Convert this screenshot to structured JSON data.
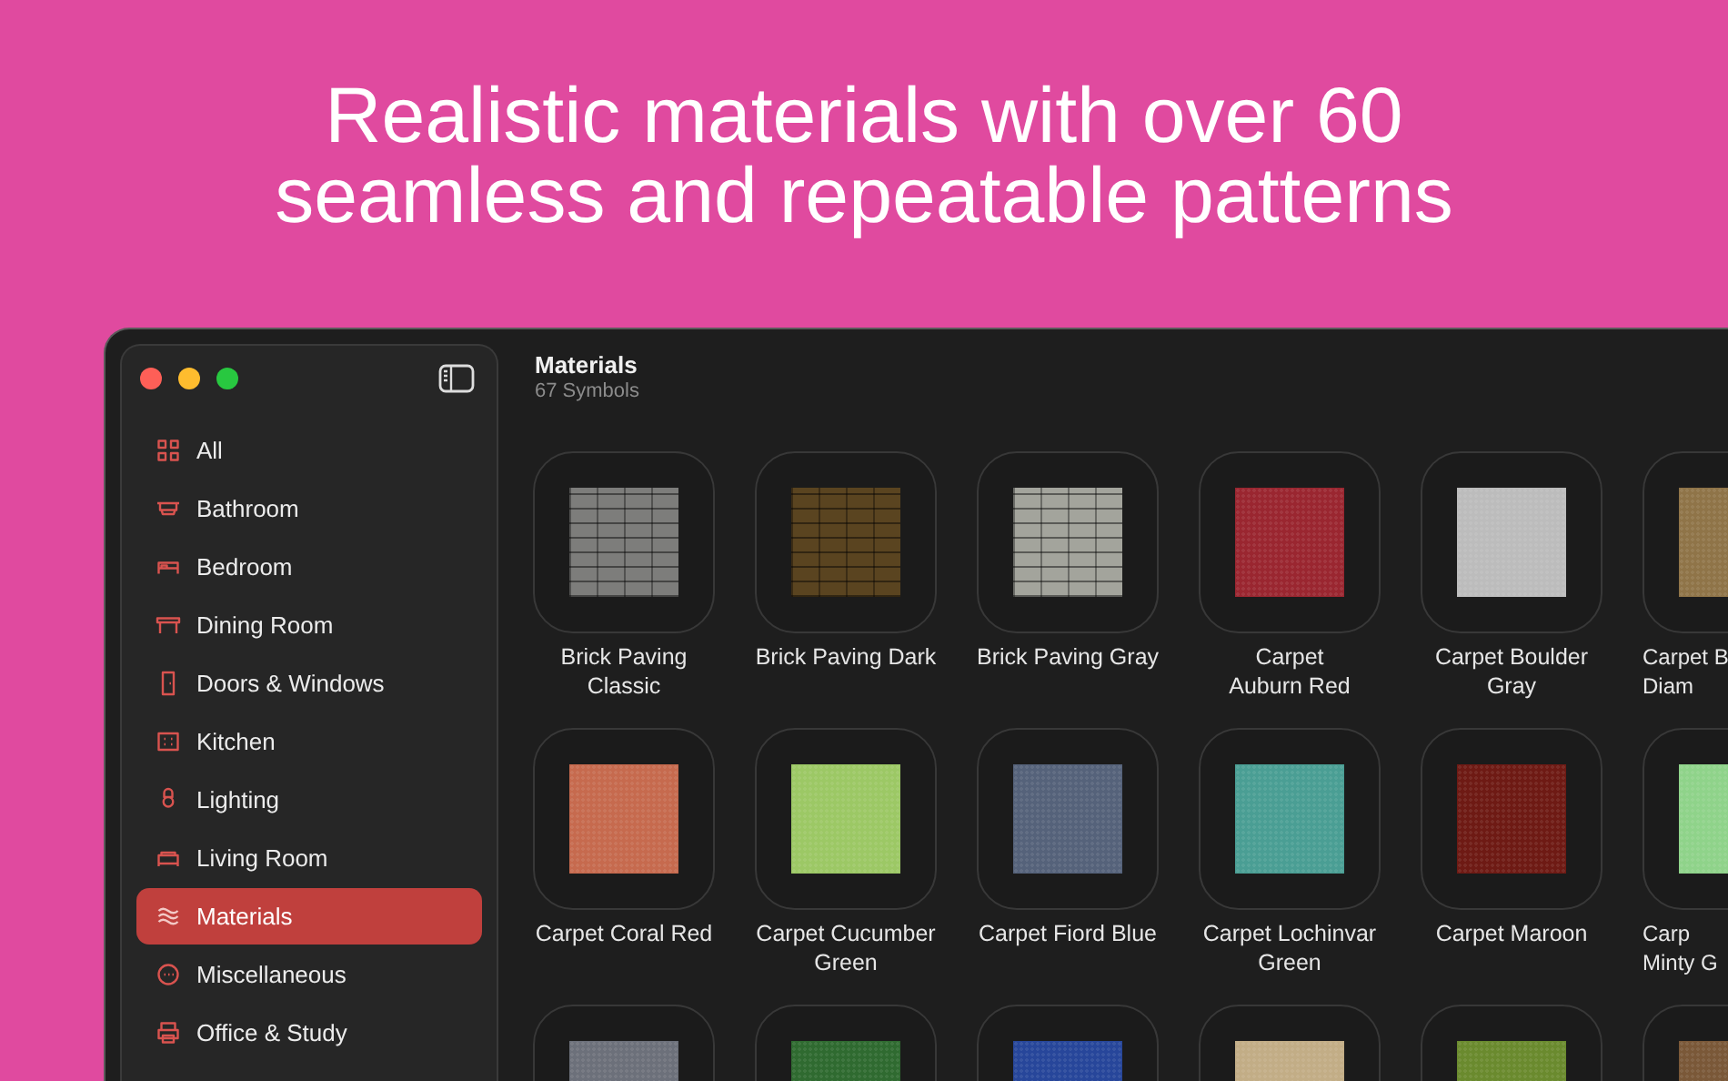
{
  "headline": [
    "Realistic materials with over 60",
    "seamless and repeatable patterns"
  ],
  "sidebar": {
    "items": [
      {
        "label": "All",
        "selected": false
      },
      {
        "label": "Bathroom",
        "selected": false
      },
      {
        "label": "Bedroom",
        "selected": false
      },
      {
        "label": "Dining Room",
        "selected": false
      },
      {
        "label": "Doors & Windows",
        "selected": false
      },
      {
        "label": "Kitchen",
        "selected": false
      },
      {
        "label": "Lighting",
        "selected": false
      },
      {
        "label": "Living Room",
        "selected": false
      },
      {
        "label": "Materials",
        "selected": true
      },
      {
        "label": "Miscellaneous",
        "selected": false
      },
      {
        "label": "Office & Study",
        "selected": false
      }
    ]
  },
  "header": {
    "title": "Materials",
    "subtitle": "67 Symbols"
  },
  "rows": [
    [
      {
        "kind": "brick",
        "color": "#7d7d7b",
        "label": "Brick Paving\nClassic"
      },
      {
        "kind": "brick",
        "color": "#5a4420",
        "label": "Brick Paving Dark"
      },
      {
        "kind": "brick",
        "color": "#a3a49c",
        "label": "Brick Paving Gray"
      },
      {
        "kind": "solid",
        "color": "#9a2630",
        "label": "Carpet\nAuburn Red"
      },
      {
        "kind": "solid",
        "color": "#bcbcbc",
        "label": "Carpet Boulder\nGray"
      },
      {
        "kind": "solid",
        "color": "#8f7448",
        "label": "Carpet B\nDiam"
      }
    ],
    [
      {
        "kind": "solid",
        "color": "#c66a4e",
        "label": "Carpet Coral Red"
      },
      {
        "kind": "solid",
        "color": "#9cc865",
        "label": "Carpet Cucumber\nGreen"
      },
      {
        "kind": "solid",
        "color": "#55627a",
        "label": "Carpet Fiord Blue"
      },
      {
        "kind": "solid",
        "color": "#4a9e94",
        "label": "Carpet Lochinvar\nGreen"
      },
      {
        "kind": "solid",
        "color": "#6e1a14",
        "label": "Carpet Maroon"
      },
      {
        "kind": "solid",
        "color": "#8fd38a",
        "label": "Carp\nMinty G"
      }
    ],
    [
      {
        "kind": "solid",
        "color": "#6c707a"
      },
      {
        "kind": "solid",
        "color": "#2f6a30"
      },
      {
        "kind": "solid",
        "color": "#27469a"
      },
      {
        "kind": "solid",
        "color": "#c2ad86"
      },
      {
        "kind": "solid",
        "color": "#6a8a2e"
      },
      {
        "kind": "solid",
        "color": "#7a5838"
      }
    ]
  ]
}
